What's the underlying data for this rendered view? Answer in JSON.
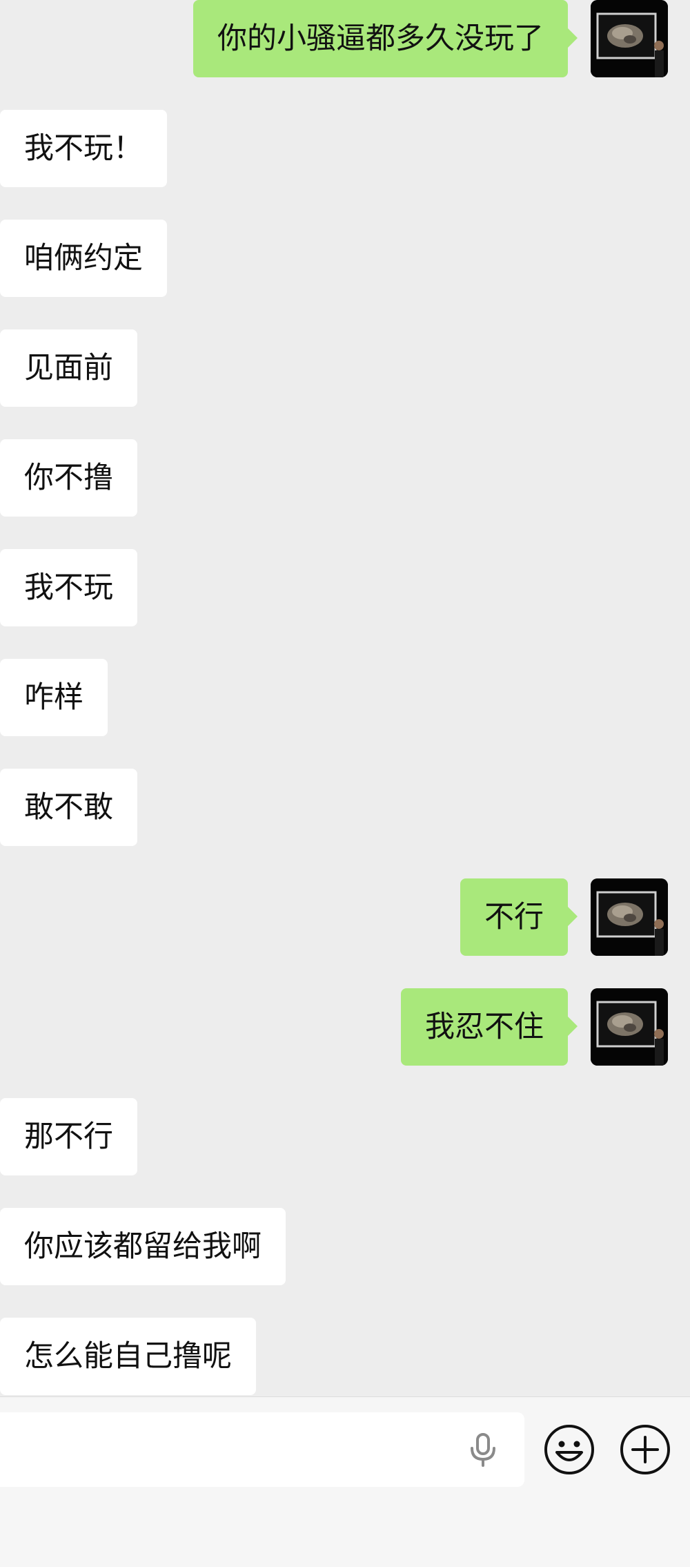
{
  "messages": [
    {
      "side": "out",
      "text": "你的小骚逼都多久没玩了"
    },
    {
      "side": "in",
      "text": "我不玩！"
    },
    {
      "side": "in",
      "text": "咱俩约定"
    },
    {
      "side": "in",
      "text": "见面前"
    },
    {
      "side": "in",
      "text": "你不撸"
    },
    {
      "side": "in",
      "text": "我不玩"
    },
    {
      "side": "in",
      "text": "咋样"
    },
    {
      "side": "in",
      "text": "敢不敢"
    },
    {
      "side": "out",
      "text": "不行"
    },
    {
      "side": "out",
      "text": "我忍不住"
    },
    {
      "side": "in",
      "text": "那不行"
    },
    {
      "side": "in",
      "text": "你应该都留给我啊"
    },
    {
      "side": "in",
      "text": "怎么能自己撸呢"
    }
  ],
  "input_bar": {
    "message_input_value": "",
    "icons": {
      "voice": "microphone-icon",
      "emoji": "emoji-icon",
      "more": "plus-icon"
    }
  },
  "colors": {
    "background": "#ededed",
    "outgoing_bubble": "#a9e87b",
    "incoming_bubble": "#ffffff"
  }
}
